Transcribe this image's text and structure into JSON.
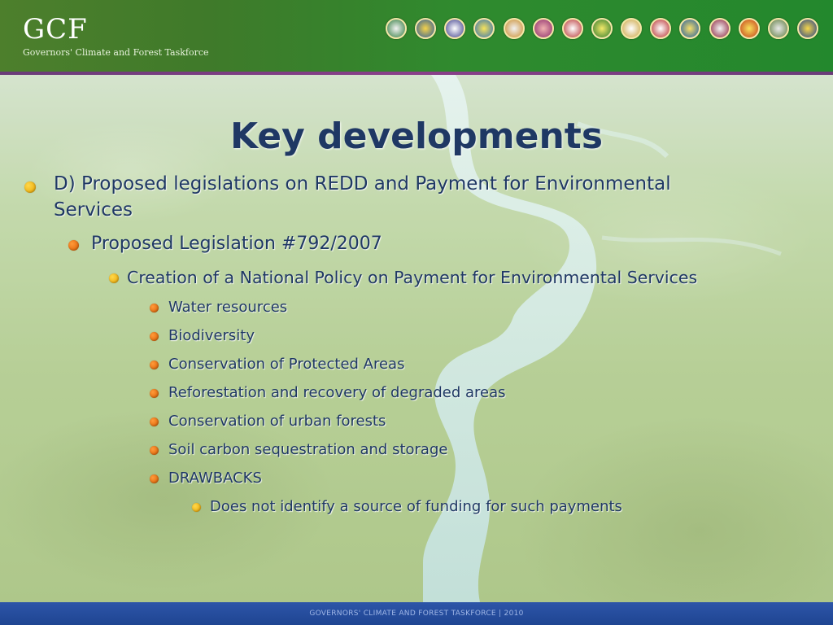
{
  "header": {
    "brand_title": "GCF",
    "brand_subtitle": "Governors' Climate and Forest Taskforce",
    "seal_labels": [
      "",
      "",
      "",
      "",
      "",
      "",
      "",
      "",
      "",
      "",
      "",
      "",
      "",
      "",
      "",
      "",
      "",
      ""
    ]
  },
  "slide": {
    "title": "Key developments",
    "bullets": [
      {
        "level": 1,
        "text": "D) Proposed legislations on REDD and Payment for Environmental"
      },
      {
        "level": 1,
        "text": "Services",
        "continuation": true
      },
      {
        "level": 2,
        "text": "Proposed Legislation #792/2007"
      },
      {
        "level": 3,
        "text": "Creation of a National Policy on Payment for Environmental Services"
      },
      {
        "level": 4,
        "text": "Water resources"
      },
      {
        "level": 4,
        "text": "Biodiversity"
      },
      {
        "level": 4,
        "text": "Conservation of Protected Areas"
      },
      {
        "level": 4,
        "text": "Reforestation and recovery of degraded areas"
      },
      {
        "level": 4,
        "text": "Conservation of urban forests"
      },
      {
        "level": 4,
        "text": "Soil carbon sequestration and storage"
      },
      {
        "level": 4,
        "text": "DRAWBACKS"
      },
      {
        "level": 5,
        "text": "Does not identify a source of funding for such payments"
      }
    ]
  },
  "footer": {
    "text": "GOVERNORS' CLIMATE AND FOREST TASKFORCE | 2010"
  },
  "colors": {
    "title": "#1f3864",
    "bullet_yellow": "#e8a300",
    "bullet_orange": "#d95c00",
    "header_green": "#2f8a2e",
    "header_stripe": "#8a3e8a",
    "footer_blue": "#1f4592"
  }
}
